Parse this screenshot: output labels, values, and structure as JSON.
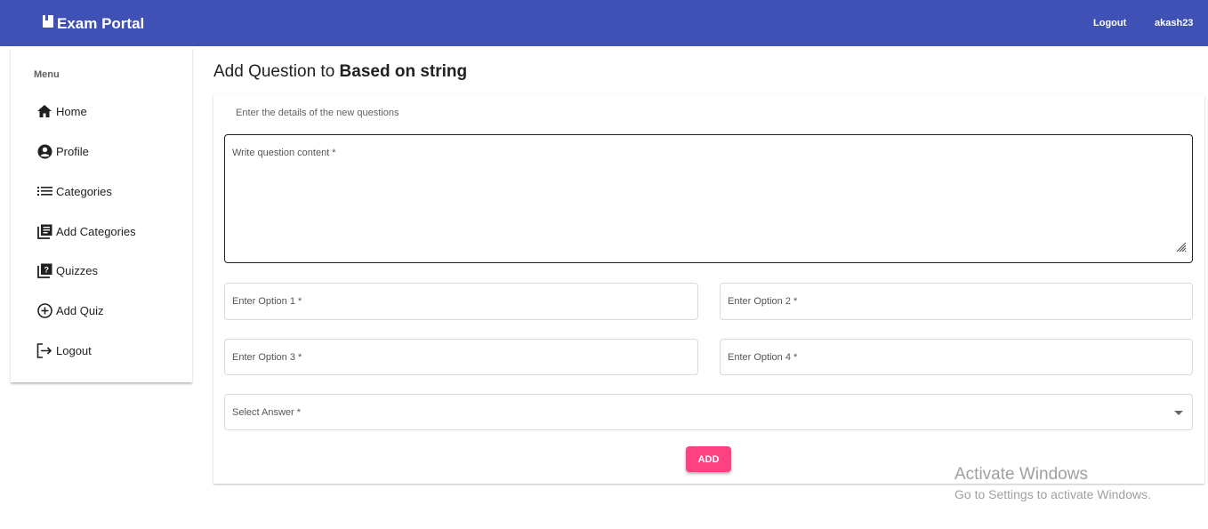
{
  "header": {
    "brand": "Exam Portal",
    "brand_icon": "book-icon",
    "logout_label": "Logout",
    "username": "akash23",
    "color": "#3f51b5"
  },
  "sidebar": {
    "heading": "Menu",
    "items": [
      {
        "label": "Home",
        "icon": "home-icon"
      },
      {
        "label": "Profile",
        "icon": "account-circle-icon"
      },
      {
        "label": "Categories",
        "icon": "list-icon"
      },
      {
        "label": "Add Categories",
        "icon": "library-books-icon"
      },
      {
        "label": "Quizzes",
        "icon": "quiz-icon"
      },
      {
        "label": "Add Quiz",
        "icon": "add-circle-icon"
      },
      {
        "label": "Logout",
        "icon": "logout-icon"
      }
    ]
  },
  "main": {
    "title_prefix": "Add Question to",
    "title_quiz": "Based on string",
    "subtitle": "Enter the details of the new questions",
    "content_label": "Write question content *",
    "option1_label": "Enter Option 1 *",
    "option2_label": "Enter Option 2 *",
    "option3_label": "Enter Option 3 *",
    "option4_label": "Enter Option 4 *",
    "answer_label": "Select Answer *",
    "add_label": "ADD",
    "add_color": "#ff4081"
  },
  "watermark": {
    "line1": "Activate Windows",
    "line2": "Go to Settings to activate Windows."
  }
}
